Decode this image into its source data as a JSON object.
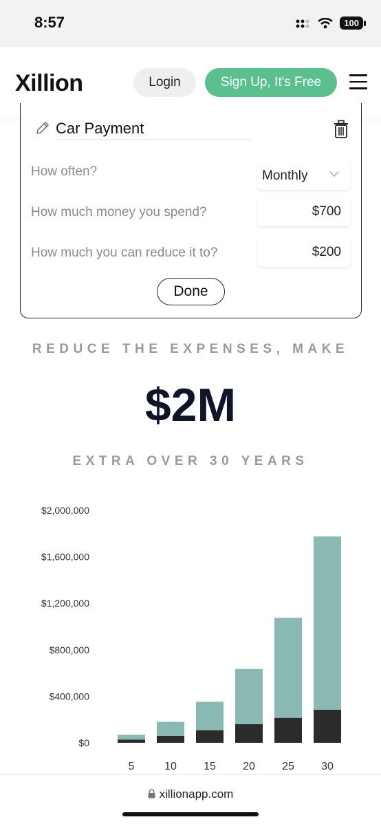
{
  "status": {
    "time": "8:57",
    "battery": "100"
  },
  "header": {
    "logo": "Xillion",
    "login": "Login",
    "signup": "Sign Up, It's Free"
  },
  "card": {
    "expense_name": "Car Payment",
    "rows": [
      {
        "label": "How often?",
        "value": "Monthly"
      },
      {
        "label": "How much money you spend?",
        "value": "$700"
      },
      {
        "label": "How much you can reduce it to?",
        "value": "$200"
      }
    ],
    "done": "Done"
  },
  "promo": {
    "line1": "REDUCE THE EXPENSES, MAKE",
    "amount": "$2M",
    "line2": "EXTRA OVER 30 YEARS"
  },
  "chart_data": {
    "type": "bar",
    "stacked": true,
    "categories": [
      "5",
      "10",
      "15",
      "20",
      "25",
      "30"
    ],
    "series": [
      {
        "values": [
          28000,
          60000,
          108000,
          160000,
          215000,
          285000
        ],
        "color": "#2b2b2b"
      },
      {
        "values": [
          40000,
          120000,
          245000,
          475000,
          860000,
          1490000
        ],
        "color": "#8ab8b3"
      }
    ],
    "yticks": [
      "$0",
      "$400,000",
      "$800,000",
      "$1,200,000",
      "$1,600,000",
      "$2,000,000"
    ],
    "ylim": [
      0,
      2000000
    ],
    "grid": false,
    "legend": "none"
  },
  "url_bar": {
    "url": "xillionapp.com"
  }
}
